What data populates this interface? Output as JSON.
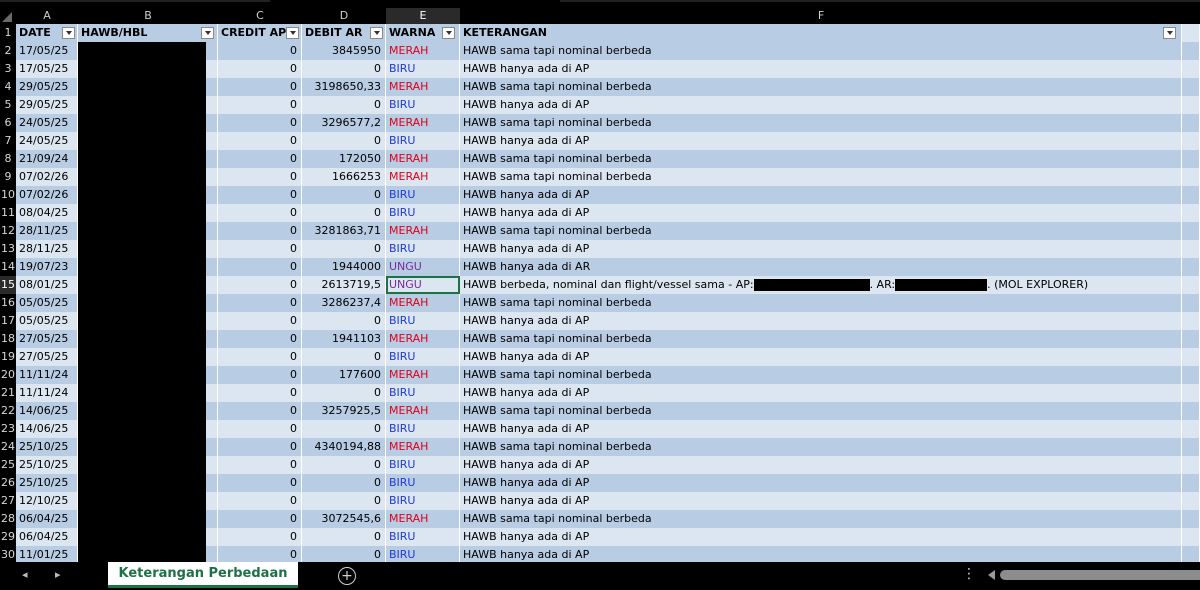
{
  "column_letters": [
    "A",
    "B",
    "C",
    "D",
    "E",
    "F"
  ],
  "headers": {
    "date": "DATE",
    "hawb": "HAWB/HBL",
    "credit_ap": "CREDIT AP",
    "debit_ar": "DEBIT AR",
    "warna": "WARNA",
    "keterangan": "KETERANGAN"
  },
  "colors": {
    "MERAH": "#e0001b",
    "BIRU": "#1f3ad6",
    "UNGU": "#7a2aa0",
    "accent": "#1e7145"
  },
  "rows": [
    {
      "n": "2",
      "date": "17/05/25",
      "credit": "0",
      "debit": "3845950",
      "warna": "MERAH",
      "ket": "HAWB sama tapi nominal berbeda"
    },
    {
      "n": "3",
      "date": "17/05/25",
      "credit": "0",
      "debit": "0",
      "warna": "BIRU",
      "ket": "HAWB hanya ada di AP"
    },
    {
      "n": "4",
      "date": "29/05/25",
      "credit": "0",
      "debit": "3198650,33",
      "warna": "MERAH",
      "ket": "HAWB sama tapi nominal berbeda"
    },
    {
      "n": "5",
      "date": "29/05/25",
      "credit": "0",
      "debit": "0",
      "warna": "BIRU",
      "ket": "HAWB hanya ada di AP"
    },
    {
      "n": "6",
      "date": "24/05/25",
      "credit": "0",
      "debit": "3296577,2",
      "warna": "MERAH",
      "ket": "HAWB sama tapi nominal berbeda"
    },
    {
      "n": "7",
      "date": "24/05/25",
      "credit": "0",
      "debit": "0",
      "warna": "BIRU",
      "ket": "HAWB hanya ada di AP"
    },
    {
      "n": "8",
      "date": "21/09/24",
      "credit": "0",
      "debit": "172050",
      "warna": "MERAH",
      "ket": "HAWB sama tapi nominal berbeda"
    },
    {
      "n": "9",
      "date": "07/02/26",
      "credit": "0",
      "debit": "1666253",
      "warna": "MERAH",
      "ket": "HAWB sama tapi nominal berbeda"
    },
    {
      "n": "10",
      "date": "07/02/26",
      "credit": "0",
      "debit": "0",
      "warna": "BIRU",
      "ket": "HAWB hanya ada di AP"
    },
    {
      "n": "11",
      "date": "08/04/25",
      "credit": "0",
      "debit": "0",
      "warna": "BIRU",
      "ket": "HAWB hanya ada di AP"
    },
    {
      "n": "12",
      "date": "28/11/25",
      "credit": "0",
      "debit": "3281863,71",
      "warna": "MERAH",
      "ket": "HAWB sama tapi nominal berbeda"
    },
    {
      "n": "13",
      "date": "28/11/25",
      "credit": "0",
      "debit": "0",
      "warna": "BIRU",
      "ket": "HAWB hanya ada di AP"
    },
    {
      "n": "14",
      "date": "19/07/23",
      "credit": "0",
      "debit": "1944000",
      "warna": "UNGU",
      "ket": "HAWB hanya ada di AR"
    },
    {
      "n": "15",
      "date": "08/01/25",
      "credit": "0",
      "debit": "2613719,5",
      "warna": "UNGU",
      "ket": "HAWB berbeda, nominal dan flight/vessel sama - AP:",
      "ket_mid": ". AR:",
      "ket_end": ". (MOL EXPLORER)"
    },
    {
      "n": "16",
      "date": "05/05/25",
      "credit": "0",
      "debit": "3286237,4",
      "warna": "MERAH",
      "ket": "HAWB sama tapi nominal berbeda"
    },
    {
      "n": "17",
      "date": "05/05/25",
      "credit": "0",
      "debit": "0",
      "warna": "BIRU",
      "ket": "HAWB hanya ada di AP"
    },
    {
      "n": "18",
      "date": "27/05/25",
      "credit": "0",
      "debit": "1941103",
      "warna": "MERAH",
      "ket": "HAWB sama tapi nominal berbeda"
    },
    {
      "n": "19",
      "date": "27/05/25",
      "credit": "0",
      "debit": "0",
      "warna": "BIRU",
      "ket": "HAWB hanya ada di AP"
    },
    {
      "n": "20",
      "date": "11/11/24",
      "credit": "0",
      "debit": "177600",
      "warna": "MERAH",
      "ket": "HAWB sama tapi nominal berbeda"
    },
    {
      "n": "21",
      "date": "11/11/24",
      "credit": "0",
      "debit": "0",
      "warna": "BIRU",
      "ket": "HAWB hanya ada di AP"
    },
    {
      "n": "22",
      "date": "14/06/25",
      "credit": "0",
      "debit": "3257925,5",
      "warna": "MERAH",
      "ket": "HAWB sama tapi nominal berbeda"
    },
    {
      "n": "23",
      "date": "14/06/25",
      "credit": "0",
      "debit": "0",
      "warna": "BIRU",
      "ket": "HAWB hanya ada di AP"
    },
    {
      "n": "24",
      "date": "25/10/25",
      "credit": "0",
      "debit": "4340194,88",
      "warna": "MERAH",
      "ket": "HAWB sama tapi nominal berbeda"
    },
    {
      "n": "25",
      "date": "25/10/25",
      "credit": "0",
      "debit": "0",
      "warna": "BIRU",
      "ket": "HAWB hanya ada di AP"
    },
    {
      "n": "26",
      "date": "25/10/25",
      "credit": "0",
      "debit": "0",
      "warna": "BIRU",
      "ket": "HAWB hanya ada di AP"
    },
    {
      "n": "27",
      "date": "12/10/25",
      "credit": "0",
      "debit": "0",
      "warna": "BIRU",
      "ket": "HAWB hanya ada di AP"
    },
    {
      "n": "28",
      "date": "06/04/25",
      "credit": "0",
      "debit": "3072545,6",
      "warna": "MERAH",
      "ket": "HAWB sama tapi nominal berbeda"
    },
    {
      "n": "29",
      "date": "06/04/25",
      "credit": "0",
      "debit": "0",
      "warna": "BIRU",
      "ket": "HAWB hanya ada di AP"
    },
    {
      "n": "30",
      "date": "11/01/25",
      "credit": "0",
      "debit": "0",
      "warna": "BIRU",
      "ket": "HAWB hanya ada di AP"
    }
  ],
  "sheet_tab": "Keterangan Perbedaan",
  "add_sheet_label": "+",
  "more_label": "⋮"
}
